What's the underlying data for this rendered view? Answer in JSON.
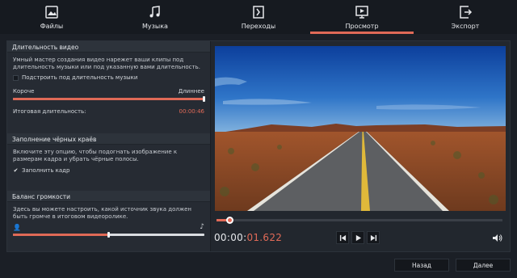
{
  "tabs": [
    {
      "label": "Файлы",
      "icon": "image-file-icon"
    },
    {
      "label": "Музыка",
      "icon": "music-note-icon"
    },
    {
      "label": "Переходы",
      "icon": "transition-icon"
    },
    {
      "label": "Просмотр",
      "icon": "preview-icon"
    },
    {
      "label": "Экспорт",
      "icon": "export-icon"
    }
  ],
  "active_tab": "Просмотр",
  "accent_color": "#e06a57",
  "video_length": {
    "title": "Длительность видео",
    "description": "Умный мастер создания видео нарежет ваши клипы под длительность музыки или под указанную вами длительность.",
    "fit_music_label": "Подстроить под длительность музыки",
    "fit_music_checked": false,
    "shorter_label": "Короче",
    "longer_label": "Длиннее",
    "slider_value": 1.0,
    "total_label": "Итоговая длительность:",
    "total_value": "00:00:46"
  },
  "black_bars": {
    "title": "Заполнение чёрных краёв",
    "description": "Включите эту опцию, чтобы подогнать изображение к размерам кадра и убрать чёрные полосы.",
    "fill_frame_label": "Заполнить кадр",
    "fill_frame_checked": true
  },
  "volume_balance": {
    "title": "Баланс громкости",
    "description": "Здесь вы можете настроить, какой источник звука должен быть громче в итоговом видеоролике.",
    "slider_value": 0.5
  },
  "player": {
    "progress": 0.04,
    "timecode_prefix": "00:00:",
    "timecode_value": "01.622"
  },
  "footer": {
    "back_label": "Назад",
    "next_label": "Далее"
  }
}
